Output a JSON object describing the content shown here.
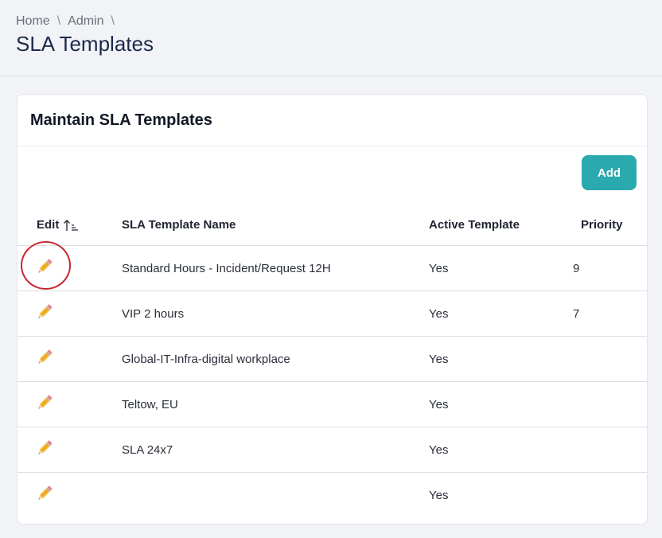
{
  "breadcrumb": {
    "home": "Home",
    "admin": "Admin",
    "sep": "\\"
  },
  "page": {
    "title": "SLA Templates"
  },
  "card": {
    "title": "Maintain SLA Templates",
    "add_label": "Add"
  },
  "table": {
    "headers": {
      "edit": "Edit",
      "name": "SLA Template Name",
      "active": "Active Template",
      "priority": "Priority"
    },
    "rows": [
      {
        "name": "Standard Hours - Incident/Request 12H",
        "active": "Yes",
        "priority": "9"
      },
      {
        "name": "VIP 2 hours",
        "active": "Yes",
        "priority": "7"
      },
      {
        "name": "Global-IT-Infra-digital workplace",
        "active": "Yes",
        "priority": ""
      },
      {
        "name": "Teltow, EU",
        "active": "Yes",
        "priority": ""
      },
      {
        "name": "SLA 24x7",
        "active": "Yes",
        "priority": ""
      },
      {
        "name": "",
        "active": "Yes",
        "priority": ""
      }
    ]
  },
  "icons": {
    "edit": "pencil-icon",
    "sort": "sort-ascending-icon"
  },
  "colors": {
    "accent": "#2aa9ae",
    "highlight": "#c8262c"
  }
}
